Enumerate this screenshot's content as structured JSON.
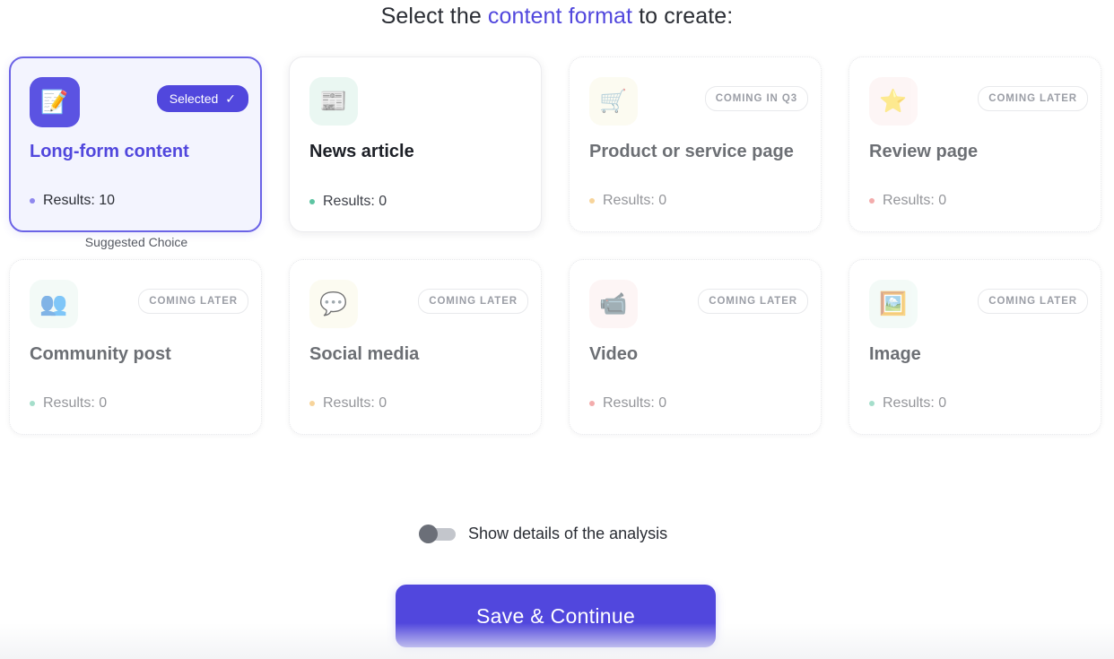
{
  "heading": {
    "before": "Select the ",
    "accent": "content format",
    "after": " to create:"
  },
  "cards": [
    {
      "title": "Long-form content",
      "results": "Results: 10",
      "icon": "memo-icon",
      "glyph": "📝",
      "badge": "Selected",
      "state": "selected",
      "dot_color": "#8f88ee",
      "tile_color": "#5b53e2"
    },
    {
      "title": "News article",
      "results": "Results: 0",
      "icon": "newspaper-icon",
      "glyph": "📰",
      "badge": "",
      "state": "available",
      "dot_color": "#5dc4a2",
      "tile_color": "#eaf7f2"
    },
    {
      "title": "Product or service page",
      "results": "Results: 0",
      "icon": "shopping-cart-icon",
      "glyph": "🛒",
      "badge": "Coming in Q3",
      "state": "disabled",
      "dot_color": "#f2b24a",
      "tile_color": "#fbf8e7"
    },
    {
      "title": "Review page",
      "results": "Results: 0",
      "icon": "star-icon",
      "glyph": "⭐",
      "badge": "Coming later",
      "state": "disabled",
      "dot_color": "#ea6a6a",
      "tile_color": "#fdeeee"
    },
    {
      "title": "Community post",
      "results": "Results: 0",
      "icon": "people-icon",
      "glyph": "👥",
      "badge": "Coming later",
      "state": "disabled",
      "dot_color": "#5dc4a2",
      "tile_color": "#eaf7f2"
    },
    {
      "title": "Social media",
      "results": "Results: 0",
      "icon": "speech-bubble-icon",
      "glyph": "💬",
      "badge": "Coming later",
      "state": "disabled",
      "dot_color": "#f2b24a",
      "tile_color": "#fbf8e7"
    },
    {
      "title": "Video",
      "results": "Results: 0",
      "icon": "video-camera-icon",
      "glyph": "📹",
      "badge": "Coming later",
      "state": "disabled",
      "dot_color": "#ea6a6a",
      "tile_color": "#fdeeee"
    },
    {
      "title": "Image",
      "results": "Results: 0",
      "icon": "picture-icon",
      "glyph": "🖼️",
      "badge": "Coming later",
      "state": "disabled",
      "dot_color": "#5dc4a2",
      "tile_color": "#eaf7f2"
    }
  ],
  "suggested_label": "Suggested Choice",
  "toggle": {
    "label": "Show details of the analysis",
    "checked": false
  },
  "save_button": {
    "label": "Save & Continue"
  },
  "colors": {
    "accent": "#5147dd"
  }
}
